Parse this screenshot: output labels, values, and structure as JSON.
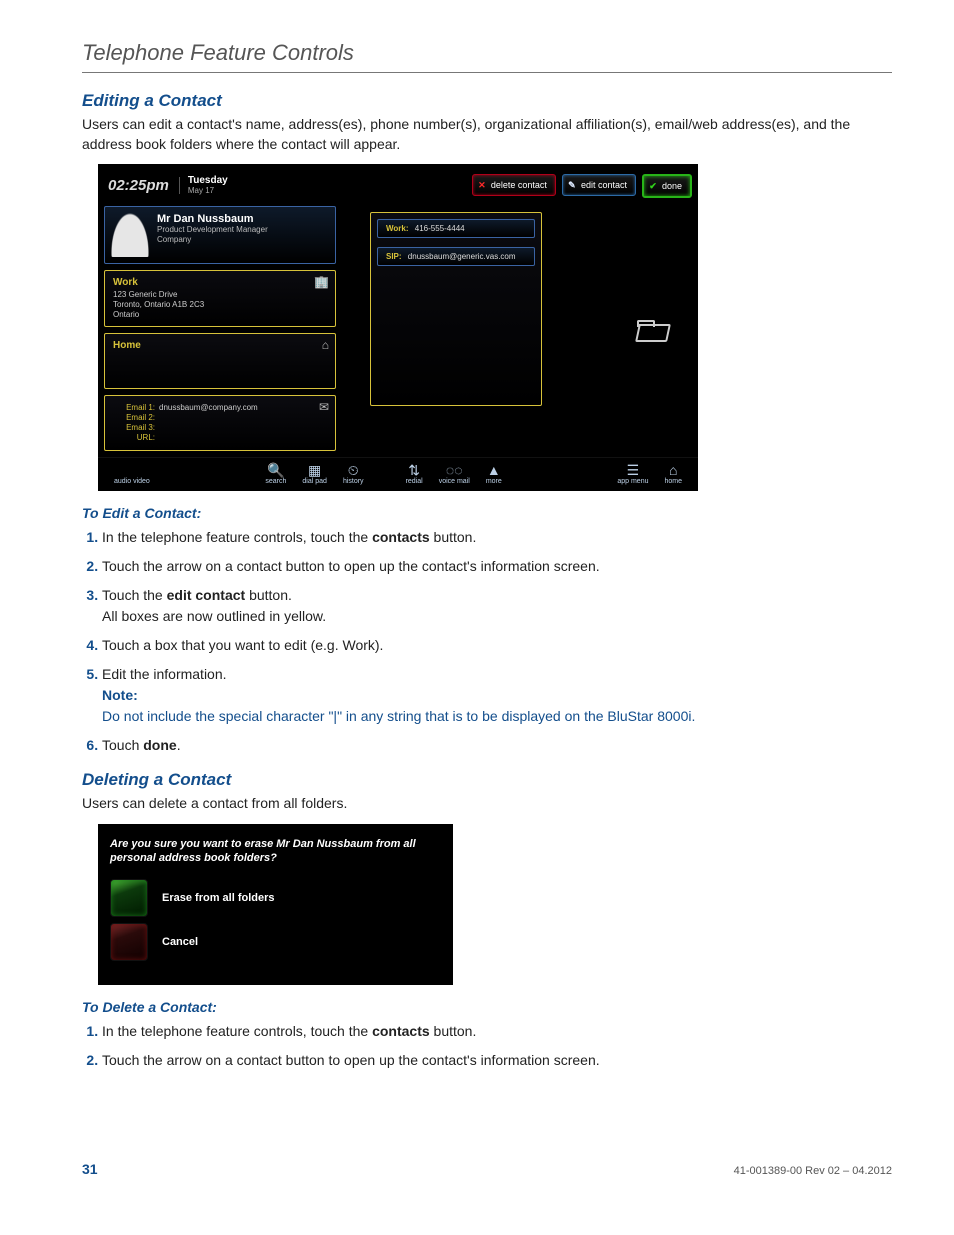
{
  "page": {
    "running_head": "Telephone Feature Controls",
    "number": "31",
    "revision": "41-001389-00 Rev 02 – 04.2012"
  },
  "sectionA": {
    "heading": "Editing a Contact",
    "intro": "Users can edit a contact's name, address(es), phone number(s), organizational affiliation(s), email/web address(es), and the address book folders where the contact will appear.",
    "sub": "To Edit a Contact:",
    "steps": {
      "s1a": "In the telephone feature controls, touch the ",
      "s1b": "contacts",
      "s1c": " button.",
      "s2": "Touch the arrow on a contact button to open up the contact's information screen.",
      "s3a": "Touch the ",
      "s3b": "edit contact",
      "s3c": " button.",
      "s3d": "All boxes are now outlined in yellow.",
      "s4": "Touch a box that you want to edit (e.g. Work).",
      "s5": "Edit the information.",
      "noteLbl": "Note:",
      "noteTxt": "Do not include the special character \"|\" in any string that is to be displayed on the BluStar 8000i.",
      "s6a": "Touch ",
      "s6b": "done",
      "s6c": "."
    }
  },
  "sectionB": {
    "heading": "Deleting a Contact",
    "intro": "Users can delete a contact from all folders.",
    "sub": "To Delete a Contact:",
    "steps": {
      "s1a": "In the telephone feature controls, touch the ",
      "s1b": "contacts",
      "s1c": " button.",
      "s2": "Touch the arrow on a contact button to open up the contact's information screen."
    }
  },
  "device1": {
    "clock": {
      "time": "02:25pm",
      "dow": "Tuesday",
      "date": "May 17"
    },
    "topbtns": {
      "delete": "delete contact",
      "edit": "edit contact",
      "done": "done"
    },
    "contact": {
      "name": "Mr Dan Nussbaum",
      "role": "Product Development Manager",
      "company": "Company"
    },
    "work": {
      "title": "Work",
      "line1": "123 Generic Drive",
      "line2": "Toronto, Ontario  A1B 2C3",
      "line3": "Ontario"
    },
    "home": {
      "title": "Home"
    },
    "emails": {
      "l1": "Email 1:",
      "v1": "dnussbaum@company.com",
      "l2": "Email 2:",
      "l3": "Email 3:",
      "l4": "URL:"
    },
    "phones": {
      "workLbl": "Work:",
      "workVal": "416-555-4444",
      "sipLbl": "SIP:",
      "sipVal": "dnussbaum@generic.vas.com"
    },
    "bottombar": {
      "audio": "audio video",
      "search": "search",
      "dialpad": "dial pad",
      "history": "history",
      "redial": "redial",
      "vm": "voice mail",
      "more": "more",
      "appmenu": "app menu",
      "home": "home"
    }
  },
  "device2": {
    "message": "Are you sure you want to erase Mr Dan Nussbaum from all personal address book folders?",
    "erase": "Erase from all folders",
    "cancel": "Cancel"
  }
}
